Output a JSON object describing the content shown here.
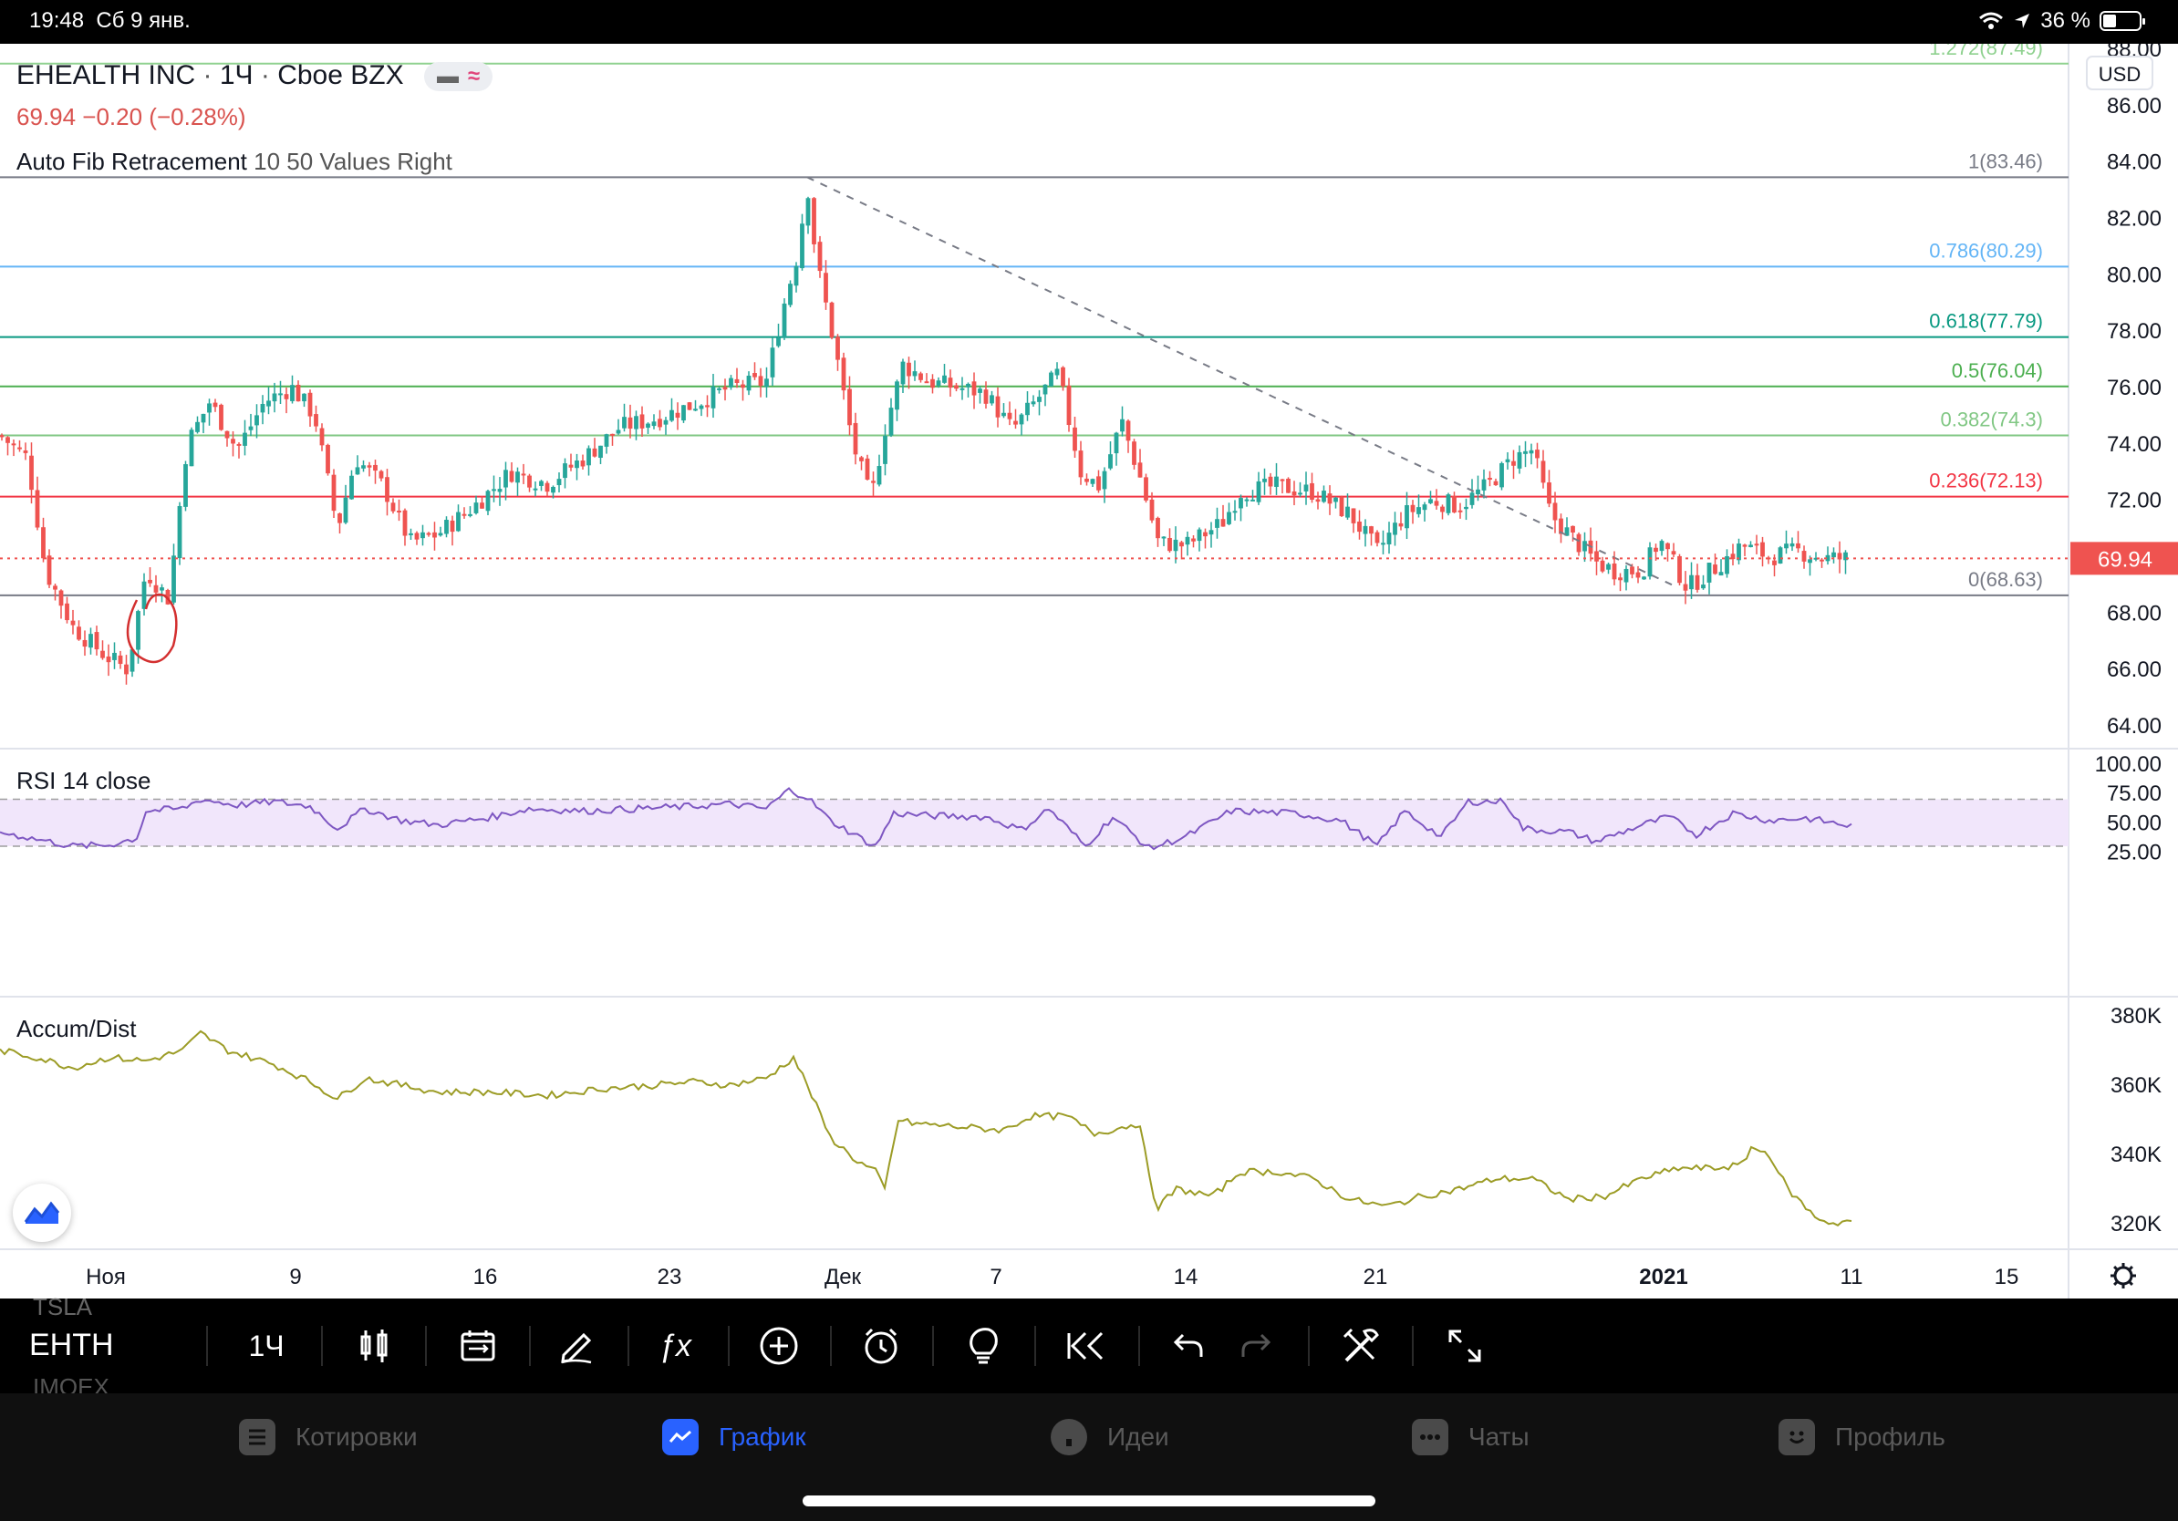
{
  "status_bar": {
    "time": "19:48",
    "date": "Сб 9 янв.",
    "battery": "36 %"
  },
  "header": {
    "symbol_name": "EHEALTH INC",
    "interval": "1Ч",
    "exchange": "Cboe BZX",
    "price_line": "69.94  −0.20 (−0.28%)",
    "fib_legend": "Auto Fib Retracement",
    "fib_params": "10 50 Values Right",
    "rsi_legend": "RSI",
    "rsi_params": "14 close",
    "ad_legend": "Accum/Dist"
  },
  "price_axis": {
    "currency": "USD",
    "ticks": [
      "88.00",
      "86.00",
      "84.00",
      "82.00",
      "80.00",
      "78.00",
      "76.00",
      "74.00",
      "72.00",
      "70.00",
      "68.00",
      "66.00",
      "64.00"
    ],
    "last_price": "69.94"
  },
  "rsi_axis": {
    "ticks": [
      "100.00",
      "75.00",
      "50.00",
      "25.00"
    ]
  },
  "ad_axis": {
    "ticks": [
      "380K",
      "360K",
      "340K",
      "320K"
    ]
  },
  "time_axis": {
    "labels": [
      "Ноя",
      "9",
      "16",
      "23",
      "Дек",
      "7",
      "14",
      "21",
      "2021",
      "11",
      "15"
    ]
  },
  "fib_levels": [
    {
      "label": "1.272(87.49)",
      "value": 87.49,
      "color": "#8fd18f"
    },
    {
      "label": "1(83.46)",
      "value": 83.46,
      "color": "#787b86"
    },
    {
      "label": "0.786(80.29)",
      "value": 80.29,
      "color": "#64b5f6"
    },
    {
      "label": "0.618(77.79)",
      "value": 77.79,
      "color": "#089981"
    },
    {
      "label": "0.5(76.04)",
      "value": 76.04,
      "color": "#4caf50"
    },
    {
      "label": "0.382(74.3)",
      "value": 74.3,
      "color": "#81c784"
    },
    {
      "label": "0.236(72.13)",
      "value": 72.13,
      "color": "#f23645"
    },
    {
      "label": "0(68.63)",
      "value": 68.63,
      "color": "#787b86"
    }
  ],
  "chart_data": [
    {
      "type": "line",
      "title": "EHEALTH INC · 1Ч · Cboe BZX",
      "note": "hourly candlestick price chart, approximated by close series",
      "x": [
        "Ноя",
        "9",
        "16",
        "23",
        "Дек",
        "7",
        "14",
        "21",
        "2021",
        "11"
      ],
      "series": [
        {
          "name": "EHEALTH INC",
          "values": [
            67.5,
            75.0,
            71.0,
            75.5,
            76.5,
            75.0,
            70.5,
            70.5,
            69.5,
            69.94
          ]
        }
      ],
      "ylim": [
        63,
        89
      ],
      "up_color": "#26a69a",
      "down_color": "#ef5350"
    },
    {
      "type": "line",
      "title": "RSI 14 close",
      "x": [
        "Ноя",
        "9",
        "16",
        "23",
        "Дек",
        "7",
        "14",
        "21",
        "2021",
        "11"
      ],
      "series": [
        {
          "name": "RSI",
          "values": [
            32,
            62,
            50,
            60,
            55,
            52,
            40,
            48,
            45,
            47
          ]
        }
      ],
      "ylim": [
        0,
        100
      ],
      "band": [
        30,
        70
      ],
      "line_color": "#7e57c2",
      "band_color": "#f1e6fb"
    },
    {
      "type": "line",
      "title": "Accum/Dist",
      "x": [
        "Ноя",
        "9",
        "16",
        "23",
        "Дек",
        "7",
        "14",
        "21",
        "2021",
        "11"
      ],
      "series": [
        {
          "name": "Accum/Dist",
          "values": [
            365,
            358,
            358,
            361,
            345,
            348,
            330,
            327,
            335,
            321
          ]
        }
      ],
      "ylabel": "K",
      "ylim": [
        314,
        384
      ],
      "line_color": "#9c9c26"
    }
  ],
  "toolbar": {
    "symbol_prev": "TSLA",
    "symbol": "EHTH",
    "symbol_next": "IMOEX",
    "interval": "1Ч",
    "icons": [
      "chart-type-icon",
      "compare-icon",
      "draw-icon",
      "indicators-icon",
      "add-icon",
      "alert-icon",
      "ideas-icon",
      "replay-icon",
      "undo-icon",
      "redo-icon",
      "settings-tools-icon",
      "fullscreen-icon"
    ]
  },
  "tabs": [
    {
      "label": "Котировки",
      "icon": "quotes-icon"
    },
    {
      "label": "График",
      "icon": "chart-icon",
      "active": true
    },
    {
      "label": "Идеи",
      "icon": "ideas-tab-icon"
    },
    {
      "label": "Чаты",
      "icon": "chats-icon"
    },
    {
      "label": "Профиль",
      "icon": "profile-icon"
    }
  ]
}
